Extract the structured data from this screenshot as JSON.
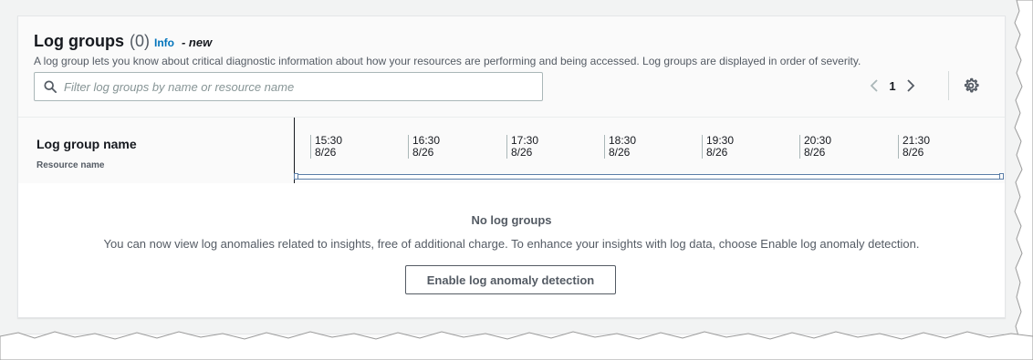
{
  "panel": {
    "title": "Log groups",
    "count": "(0)",
    "info_label": "Info",
    "new_tag": "- new",
    "description": "A log group lets you know about critical diagnostic information about how your resources are performing and being accessed. Log groups are displayed in order of severity."
  },
  "search": {
    "placeholder": "Filter log groups by name or resource name",
    "value": ""
  },
  "pagination": {
    "current_page": "1",
    "prev_icon": "chevron-left-icon",
    "next_icon": "chevron-right-icon"
  },
  "settings": {
    "icon": "gear-icon"
  },
  "table": {
    "column_title": "Log group name",
    "column_subtitle": "Resource name",
    "timeline_ticks": [
      {
        "time": "15:30",
        "date": "8/26"
      },
      {
        "time": "16:30",
        "date": "8/26"
      },
      {
        "time": "17:30",
        "date": "8/26"
      },
      {
        "time": "18:30",
        "date": "8/26"
      },
      {
        "time": "19:30",
        "date": "8/26"
      },
      {
        "time": "20:30",
        "date": "8/26"
      },
      {
        "time": "21:30",
        "date": "8/26"
      }
    ]
  },
  "empty_state": {
    "title": "No log groups",
    "description": "You can now view log anomalies related to insights, free of additional charge. To enhance your insights with log data, choose Enable log anomaly detection.",
    "button_label": "Enable log anomaly detection"
  },
  "colors": {
    "accent_link": "#0073bb",
    "text_primary": "#16191f",
    "text_secondary": "#545b64",
    "range_border": "#5b7ea8"
  }
}
